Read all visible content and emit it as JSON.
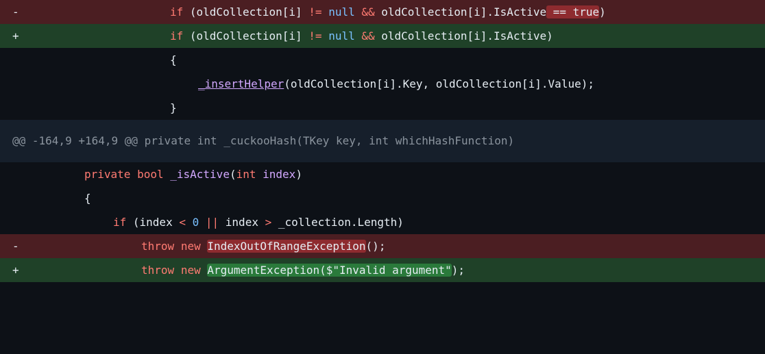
{
  "markers": {
    "del": "-",
    "add": "+"
  },
  "lines": {
    "l1": {
      "if": "if",
      "a": " (oldCollection[i] ",
      "neq": "!=",
      "b": " ",
      "null": "null",
      "c": " ",
      "and": "&&",
      "d": " oldCollection[i].IsActive",
      "hl": " == true",
      "e": ")"
    },
    "l2": {
      "if": "if",
      "a": " (oldCollection[i] ",
      "neq": "!=",
      "b": " ",
      "null": "null",
      "c": " ",
      "and": "&&",
      "d": " oldCollection[i].IsActive)"
    },
    "l3": {
      "text": "{"
    },
    "l4": {
      "fn": "_insertHelper",
      "rest": "(oldCollection[i].Key, oldCollection[i].Value);"
    },
    "l5": {
      "text": "}"
    },
    "hunk": {
      "text": "@@ -164,9 +164,9 @@ private int _cuckooHash(TKey key, int whichHashFunction)"
    },
    "l6": {
      "private": "private",
      "bool": "bool",
      "fn": "_isActive",
      "open": "(",
      "int": "int",
      "param": "index",
      "close": ")"
    },
    "l7": {
      "text": "{"
    },
    "l8": {
      "if": "if",
      "a": " (index ",
      "lt": "<",
      "b": " ",
      "zero": "0",
      "c": " ",
      "or": "||",
      "d": " index ",
      "gt": ">",
      "e": " _collection.Length)"
    },
    "l9": {
      "throw": "throw",
      "new": "new",
      "hl": "IndexOutOfRangeException",
      "rest": "();"
    },
    "l10": {
      "throw": "throw",
      "new": "new",
      "hl": "ArgumentException($\"Invalid argument\"",
      "rest": ");"
    }
  },
  "colors": {
    "deleted_line": "#4b1e22",
    "added_line": "#1f4128",
    "hunk_header": "#161f2b",
    "background": "#0d1117",
    "keyword": "#ff7b72",
    "function": "#d2a8ff",
    "literal": "#79c0ff"
  }
}
